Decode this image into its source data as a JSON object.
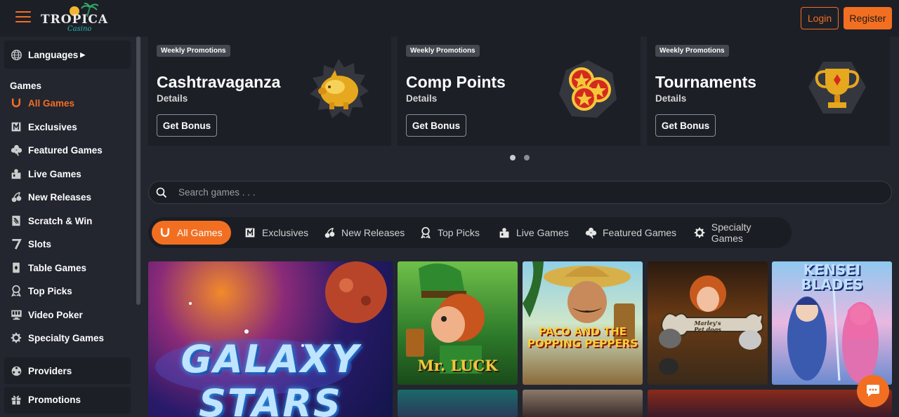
{
  "header": {
    "logo_text": "TROPICA",
    "logo_sub": "Casino",
    "login_label": "Login",
    "register_label": "Register"
  },
  "sidebar": {
    "languages_label": "Languages",
    "games_heading": "Games",
    "items": [
      {
        "label": "All Games",
        "icon": "horseshoe-icon"
      },
      {
        "label": "Exclusives",
        "icon": "exclusive-icon"
      },
      {
        "label": "Featured Games",
        "icon": "clover-icon"
      },
      {
        "label": "Live Games",
        "icon": "dealer-icon"
      },
      {
        "label": "New Releases",
        "icon": "cherries-icon"
      },
      {
        "label": "Scratch & Win",
        "icon": "scratch-card-icon"
      },
      {
        "label": "Slots",
        "icon": "seven-icon"
      },
      {
        "label": "Table Games",
        "icon": "cards-icon"
      },
      {
        "label": "Top Picks",
        "icon": "medal-icon"
      },
      {
        "label": "Video Poker",
        "icon": "monitor-icon"
      },
      {
        "label": "Specialty Games",
        "icon": "gear-icon"
      }
    ],
    "providers_label": "Providers",
    "promotions_label": "Promotions"
  },
  "promos": [
    {
      "tag": "Weekly Promotions",
      "title": "Cashtravaganza",
      "details": "Details",
      "button": "Get Bonus",
      "art": "piggy-bank"
    },
    {
      "tag": "Weekly Promotions",
      "title": "Comp Points",
      "details": "Details",
      "button": "Get Bonus",
      "art": "star-coins"
    },
    {
      "tag": "Weekly Promotions",
      "title": "Tournaments",
      "details": "Details",
      "button": "Get Bonus",
      "art": "trophy"
    }
  ],
  "carousel": {
    "active_index": 0,
    "count": 2
  },
  "search": {
    "placeholder": "Search games . . ."
  },
  "tabs": [
    {
      "label": "All Games",
      "icon": "horseshoe-icon",
      "active": true
    },
    {
      "label": "Exclusives",
      "icon": "exclusive-icon",
      "active": false
    },
    {
      "label": "New Releases",
      "icon": "cherries-icon",
      "active": false
    },
    {
      "label": "Top Picks",
      "icon": "medal-icon",
      "active": false
    },
    {
      "label": "Live Games",
      "icon": "dealer-icon",
      "active": false
    },
    {
      "label": "Featured Games",
      "icon": "clover-icon",
      "active": false
    },
    {
      "label": "Specialty Games",
      "icon": "gear-icon",
      "active": false
    }
  ],
  "games": [
    {
      "name": "GALAXY STARS"
    },
    {
      "name": "Mr. LUCK"
    },
    {
      "name": "PACO AND THE POPPING PEPPERS"
    },
    {
      "name": "Marley's Pet dogs"
    },
    {
      "name": "KENSEI BLADES"
    }
  ],
  "colors": {
    "accent": "#f26f21",
    "background": "#23252f",
    "panel": "#1d1f27"
  }
}
